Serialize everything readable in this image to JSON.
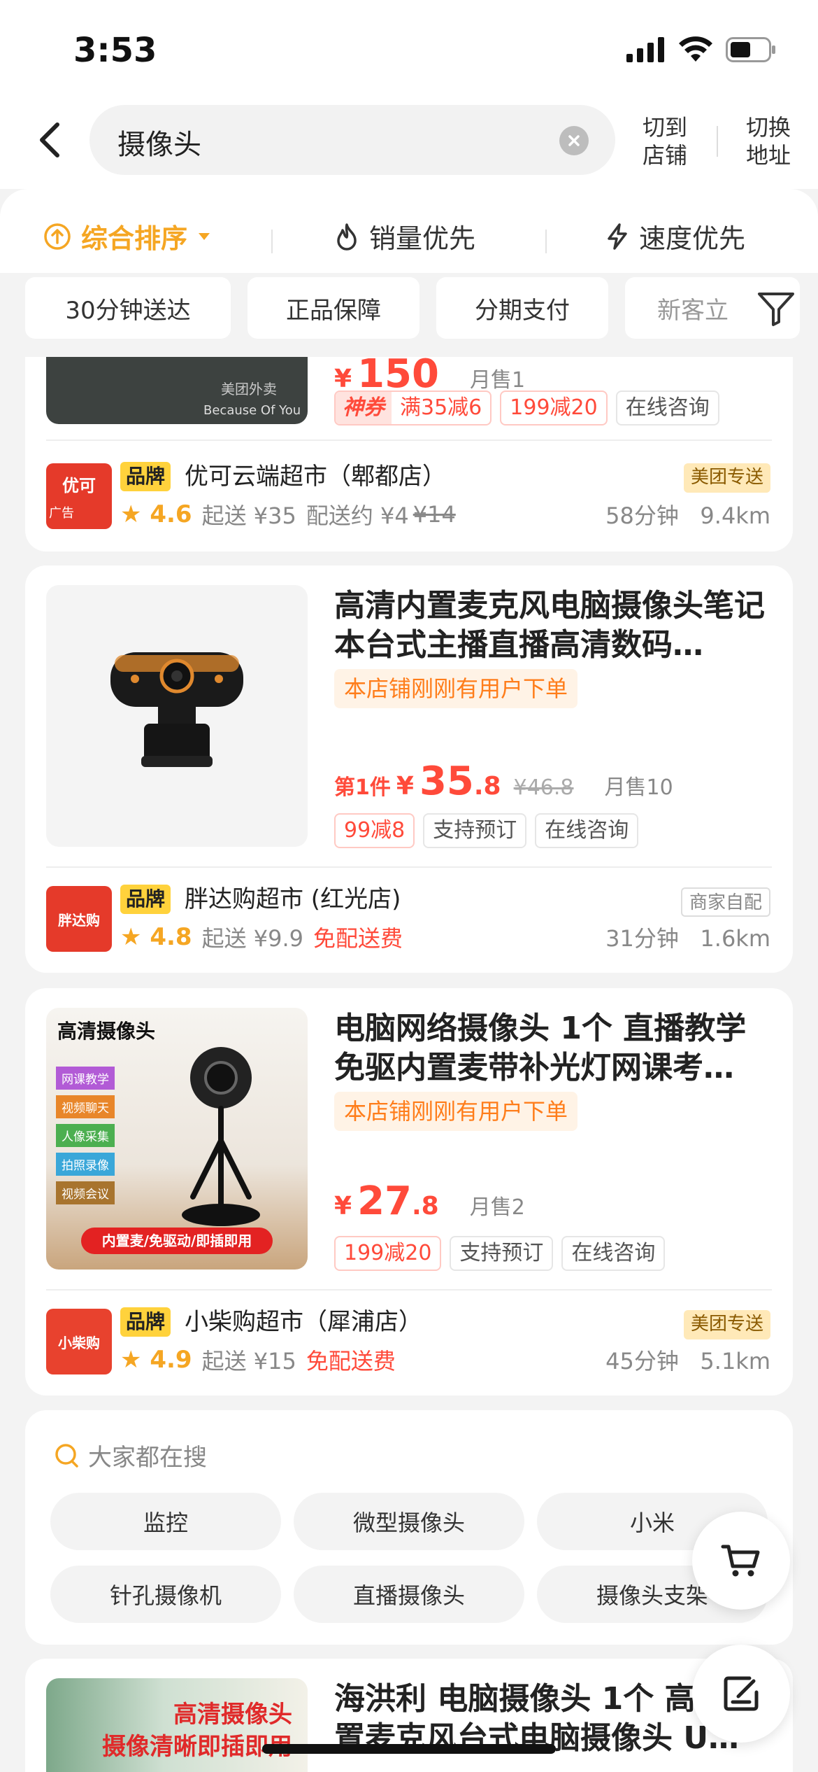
{
  "status_bar": {
    "time": "3:53"
  },
  "search": {
    "query": "摄像头",
    "switch_store": "切到店铺",
    "switch_address": "切换地址"
  },
  "sort": {
    "items": [
      {
        "label": "综合排序"
      },
      {
        "label": "销量优先"
      },
      {
        "label": "速度优先"
      }
    ]
  },
  "filters": {
    "chips": [
      "30分钟送达",
      "正品保障",
      "分期支付",
      "新客立"
    ]
  },
  "cards": [
    {
      "price_int": "150",
      "price_yen": "¥",
      "sold": "月售1",
      "tags": [
        {
          "text": "神券"
        },
        {
          "text": "满35减6"
        },
        {
          "text": "199减20"
        },
        {
          "text": "在线咨询"
        }
      ],
      "thumb_caption": "美团外卖",
      "thumb_caption2": "Because Of You",
      "shop": {
        "logo_text": "优可",
        "ad_label": "广告",
        "brand": "品牌",
        "name": "优可云端超市（郫都店）",
        "rating": "4.6",
        "min_order": "起送 ¥35",
        "delivery_fee": "配送约 ¥4",
        "delivery_fee_orig": "¥14",
        "time": "58分钟",
        "distance": "9.4km",
        "badge": "美团专送"
      }
    },
    {
      "title": "高清内置麦克风电脑摄像头笔记本台式主播直播高清数码…",
      "hint": "本店铺刚刚有用户下单",
      "price_prefix": "第1件",
      "price_yen": "¥",
      "price_int": "35",
      "price_dec": ".8",
      "price_orig": "¥46.8",
      "sold": "月售10",
      "tags": [
        {
          "text": "99减8"
        },
        {
          "text": "支持预订"
        },
        {
          "text": "在线咨询"
        }
      ],
      "shop": {
        "logo_text": "胖达购",
        "brand": "品牌",
        "name": "胖达购超市 (红光店)",
        "rating": "4.8",
        "min_order": "起送 ¥9.9",
        "delivery_fee": "免配送费",
        "time": "31分钟",
        "distance": "1.6km",
        "badge": "商家自配"
      }
    },
    {
      "title": "电脑网络摄像头 1个 直播教学免驱内置麦带补光灯网课考…",
      "hint": "本店铺刚刚有用户下单",
      "price_yen": "¥",
      "price_int": "27",
      "price_dec": ".8",
      "sold": "月售2",
      "tags": [
        {
          "text": "199减20"
        },
        {
          "text": "支持预订"
        },
        {
          "text": "在线咨询"
        }
      ],
      "thumb_title": "高清摄像头",
      "thumb_features": [
        "网课教学",
        "视频聊天",
        "人像采集",
        "拍照录像",
        "视频会议"
      ],
      "thumb_banner": "内置麦/免驱动/即插即用",
      "shop": {
        "logo_text": "小柴购",
        "brand": "品牌",
        "name": "小柴购超市（犀浦店）",
        "rating": "4.9",
        "min_order": "起送 ¥15",
        "delivery_fee": "免配送费",
        "time": "45分钟",
        "distance": "5.1km",
        "badge": "美团专送"
      }
    },
    {
      "title": "海洪利 电脑摄像头 1个 高清内置麦克风台式电脑摄像头 U…",
      "thumb_line1": "高清摄像头",
      "thumb_line2": "摄像清晰即插即用"
    }
  ],
  "popular": {
    "title": "大家都在搜",
    "items": [
      "监控",
      "微型摄像头",
      "小米",
      "针孔摄像机",
      "直播摄像头",
      "摄像头支架"
    ]
  },
  "colors": {
    "accent": "#f5a623",
    "price": "#ff4a3a",
    "brand_yellow": "#ffd23c"
  }
}
